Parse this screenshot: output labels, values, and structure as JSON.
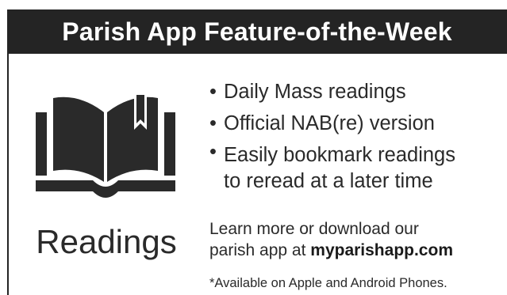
{
  "header": {
    "title": "Parish App Feature-of-the-Week"
  },
  "feature": {
    "name": "Readings",
    "icon": "open-book-bookmark-icon"
  },
  "bullets": [
    {
      "marker": "•",
      "text": "Daily Mass readings"
    },
    {
      "marker": "•",
      "text": "Official NAB(re) version"
    },
    {
      "marker": "•",
      "text": "Easily bookmark readings",
      "text_line2": "to reread at a later time"
    }
  ],
  "cta": {
    "line1": "Learn more or download our",
    "line2_prefix": "parish app at ",
    "url": "myparishapp.com"
  },
  "footnote": "*Available on Apple and Android Phones.",
  "colors": {
    "header_bg": "#242424",
    "header_text": "#ffffff",
    "body_text": "#2a2a2a"
  }
}
